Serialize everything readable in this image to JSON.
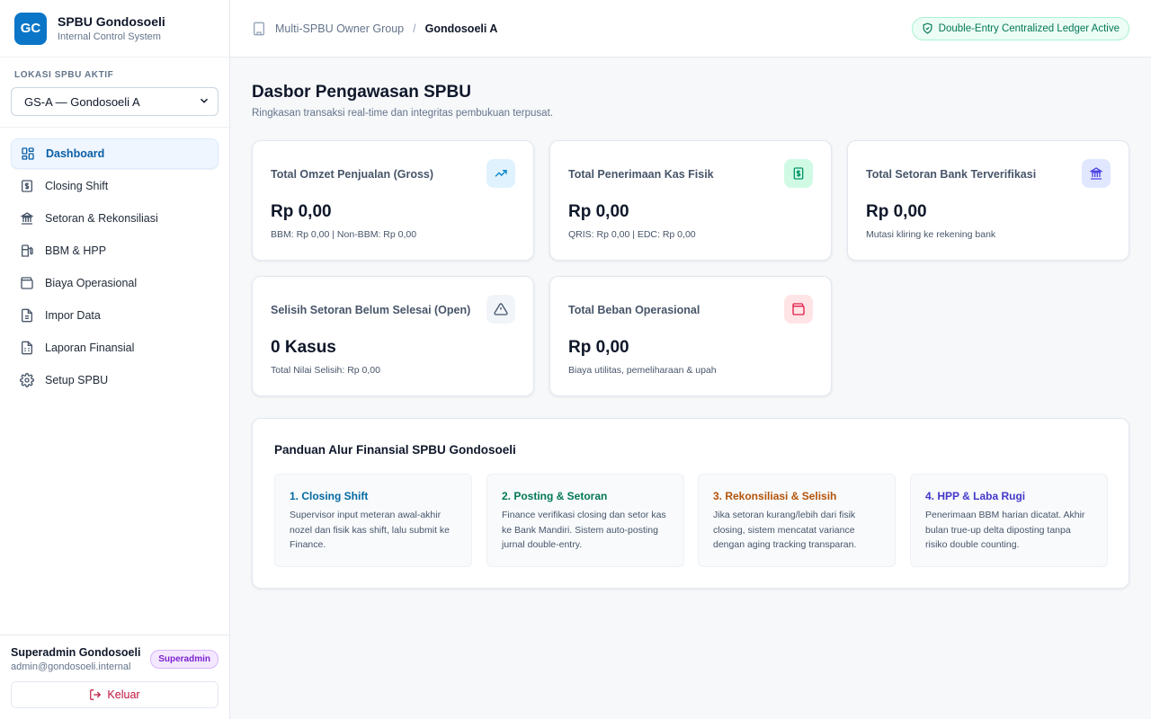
{
  "brand": {
    "logo": "GC",
    "name": "SPBU Gondosoeli",
    "subtitle": "Internal Control System"
  },
  "location": {
    "label": "LOKASI SPBU AKTIF",
    "selected": "GS-A — Gondosoeli A"
  },
  "nav": [
    {
      "label": "Dashboard",
      "icon": "dashboard-icon",
      "active": true
    },
    {
      "label": "Closing Shift",
      "icon": "dollar-icon"
    },
    {
      "label": "Setoran & Rekonsiliasi",
      "icon": "bank-icon"
    },
    {
      "label": "BBM & HPP",
      "icon": "fuel-icon"
    },
    {
      "label": "Biaya Operasional",
      "icon": "wallet-icon"
    },
    {
      "label": "Impor Data",
      "icon": "file-icon"
    },
    {
      "label": "Laporan Finansial",
      "icon": "report-icon"
    },
    {
      "label": "Setup SPBU",
      "icon": "gear-icon"
    }
  ],
  "user": {
    "name": "Superadmin Gondosoeli",
    "email": "admin@gondosoeli.internal",
    "role": "Superadmin",
    "logout": "Keluar"
  },
  "header": {
    "group": "Multi-SPBU Owner Group",
    "separator": "/",
    "current": "Gondosoeli A",
    "badge": "Double-Entry Centralized Ledger Active"
  },
  "page": {
    "title": "Dasbor Pengawasan SPBU",
    "subtitle": "Ringkasan transaksi real-time dan integritas pembukuan terpusat."
  },
  "cards": [
    {
      "title": "Total Omzet Penjualan (Gross)",
      "value": "Rp 0,00",
      "note": "BBM: Rp 0,00 | Non-BBM: Rp 0,00",
      "icon": "trending-up-icon",
      "color": "#0284c7",
      "bg": "#e0f2fe"
    },
    {
      "title": "Total Penerimaan Kas Fisik",
      "value": "Rp 0,00",
      "note": "QRIS: Rp 0,00 | EDC: Rp 0,00",
      "icon": "cash-icon",
      "color": "#059669",
      "bg": "#d1fae5"
    },
    {
      "title": "Total Setoran Bank Terverifikasi",
      "value": "Rp 0,00",
      "note": "Mutasi kliring ke rekening bank",
      "icon": "bank-icon",
      "color": "#4f46e5",
      "bg": "#e0e7ff"
    },
    {
      "title": "Selisih Setoran Belum Selesai (Open)",
      "value": "0 Kasus",
      "note": "Total Nilai Selisih: Rp 0,00",
      "icon": "warning-icon",
      "color": "#475569",
      "bg": "#f1f5f9"
    },
    {
      "title": "Total Beban Operasional",
      "value": "Rp 0,00",
      "note": "Biaya utilitas, pemeliharaan & upah",
      "icon": "wallet-icon",
      "color": "#e11d48",
      "bg": "#ffe4e6"
    }
  ],
  "guide": {
    "title": "Panduan Alur Finansial SPBU Gondosoeli",
    "steps": [
      {
        "title": "1. Closing Shift",
        "text": "Supervisor input meteran awal-akhir nozel dan fisik kas shift, lalu submit ke Finance.",
        "color": "#0369a1"
      },
      {
        "title": "2. Posting & Setoran",
        "text": "Finance verifikasi closing dan setor kas ke Bank Mandiri. Sistem auto-posting jurnal double-entry.",
        "color": "#047857"
      },
      {
        "title": "3. Rekonsiliasi & Selisih",
        "text": "Jika setoran kurang/lebih dari fisik closing, sistem mencatat variance dengan aging tracking transparan.",
        "color": "#b45309"
      },
      {
        "title": "4. HPP & Laba Rugi",
        "text": "Penerimaan BBM harian dicatat. Akhir bulan true-up delta diposting tanpa risiko double counting.",
        "color": "#4338ca"
      }
    ]
  }
}
